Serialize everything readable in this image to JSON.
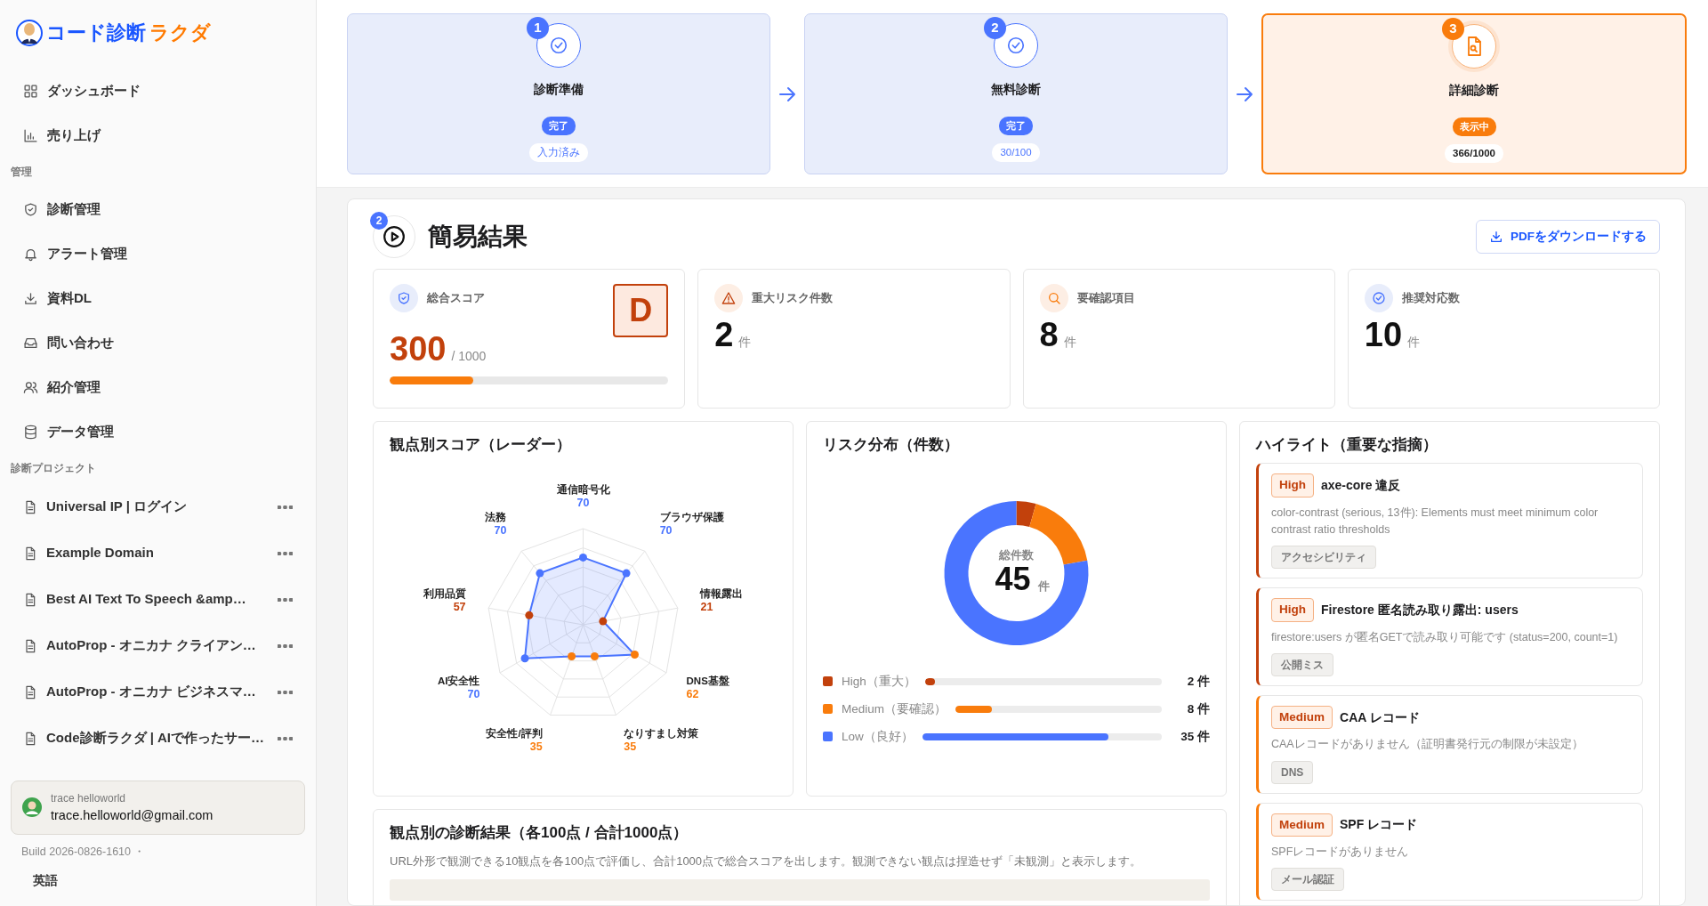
{
  "brand": {
    "main": "コード診断",
    "accent": "ラクダ"
  },
  "nav": [
    {
      "label": "ダッシュボード"
    },
    {
      "label": "売り上げ"
    }
  ],
  "sections": [
    {
      "title": "管理",
      "kind": "menu",
      "items": [
        {
          "label": "診断管理"
        },
        {
          "label": "アラート管理"
        },
        {
          "label": "資料DL"
        },
        {
          "label": "問い合わせ"
        },
        {
          "label": "紹介管理"
        },
        {
          "label": "データ管理"
        }
      ]
    },
    {
      "title": "診断プロジェクト",
      "kind": "projects",
      "items": [
        {
          "label": "Universal IP | ログイン"
        },
        {
          "label": "Example Domain"
        },
        {
          "label": "Best AI Text To Speech &amp…"
        },
        {
          "label": "AutoProp - オニカナ クライアン…"
        },
        {
          "label": "AutoProp - オニカナ ビジネスマ…"
        },
        {
          "label": "Code診断ラクダ | AIで作ったサー…"
        }
      ]
    }
  ],
  "user": {
    "name": "trace helloworld",
    "email": "trace.helloworld@gmail.com"
  },
  "build": "Build 2026-0826-1610 ・",
  "language": "英語",
  "steps": [
    {
      "number": "1",
      "title": "診断準備",
      "status": "完了",
      "detail": "入力済み",
      "selected": false
    },
    {
      "number": "2",
      "title": "無料診断",
      "status": "完了",
      "detail": "30/100",
      "selected": false
    },
    {
      "number": "3",
      "title": "詳細診断",
      "status": "表示中",
      "detail": "366/1000",
      "selected": true
    }
  ],
  "results": {
    "step_number": "2",
    "title": "簡易結果",
    "download_button": "PDFをダウンロードする"
  },
  "stats": [
    {
      "kind": "score",
      "label": "総合スコア",
      "value": "300",
      "suffix": "/ 1000",
      "grade": "D",
      "level": 0.3
    },
    {
      "kind": "alert",
      "label": "重大リスク件数",
      "value": "2",
      "suffix": "件"
    },
    {
      "kind": "review",
      "label": "要確認項目",
      "value": "8",
      "suffix": "件"
    },
    {
      "kind": "action",
      "label": "推奨対応数",
      "value": "10",
      "suffix": "件"
    }
  ],
  "radar": {
    "title": "観点別スコア（レーダー）",
    "axes": [
      {
        "label": "通信暗号化",
        "value": "70",
        "color": "#4a74ff"
      },
      {
        "label": "法務",
        "value": "70",
        "color": "#4a74ff"
      },
      {
        "label": "ブラウザ保護",
        "value": "70",
        "color": "#4a74ff"
      },
      {
        "label": "利用品質",
        "value": "57",
        "color": "#c2410c"
      },
      {
        "label": "情報露出",
        "value": "21",
        "color": "#c2410c"
      },
      {
        "label": "AI安全性",
        "value": "70",
        "color": "#4a74ff"
      },
      {
        "label": "DNS基盤",
        "value": "62",
        "color": "#f97c0c"
      },
      {
        "label": "安全性/評判",
        "value": "35",
        "color": "#f97c0c"
      },
      {
        "label": "なりすまし対策",
        "value": "35",
        "color": "#f97c0c"
      }
    ]
  },
  "risk": {
    "title": "リスク分布（件数）",
    "center_label": "総件数",
    "center_value": "45",
    "center_unit": "件",
    "chart_data": {
      "type": "donut",
      "categories": [
        "High（重大）",
        "Medium（要確認）",
        "Low（良好）"
      ],
      "values": [
        4.4,
        17.8,
        77.8
      ]
    },
    "legend": [
      {
        "count": "2 件",
        "level": 0.044,
        "color": "#c2410c"
      },
      {
        "count": "8 件",
        "level": 0.178,
        "color": "#f97c0c"
      },
      {
        "count": "35 件",
        "level": 0.778,
        "color": "#4a74ff"
      }
    ]
  },
  "highlights": {
    "title": "ハイライト（重要な指摘）",
    "items": [
      {
        "kind": "high",
        "severity": "High",
        "title": "axe-core 違反",
        "description": "color-contrast (serious, 13件): Elements must meet minimum color contrast ratio thresholds",
        "tag": "アクセシビリティ"
      },
      {
        "kind": "high",
        "severity": "High",
        "title": "Firestore 匿名読み取り露出: users",
        "description": "firestore:users が匿名GETで読み取り可能です (status=200, count=1)",
        "tag": "公開ミス"
      },
      {
        "kind": "medium",
        "severity": "Medium",
        "title": "CAA レコード",
        "description": "CAAレコードがありません（証明書発行元の制限が未設定）",
        "tag": "DNS"
      },
      {
        "kind": "medium",
        "severity": "Medium",
        "title": "SPF レコード",
        "description": "SPFレコードがありません",
        "tag": "メール認証"
      }
    ]
  },
  "details": {
    "title": "観点別の診断結果（各100点 / 合計1000点）",
    "description": "URL外形で観測できる10観点を各100点で評価し、合計1000点で総合スコアを出します。観測できない観点は捏造せず「未観測」と表示します。"
  }
}
